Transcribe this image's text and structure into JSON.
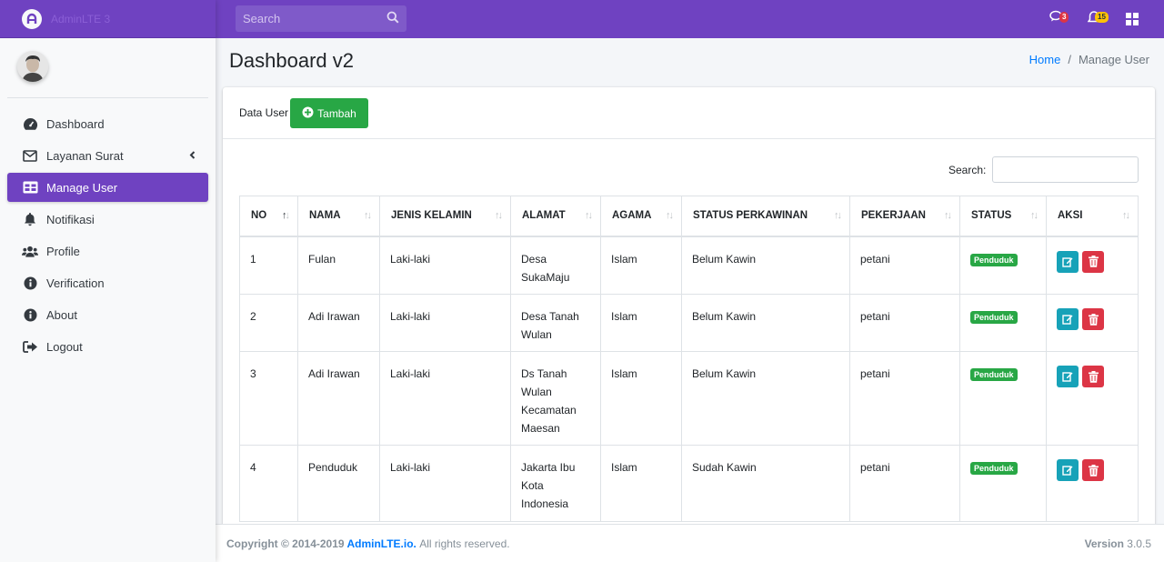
{
  "brand": {
    "name": "AdminLTE 3"
  },
  "navbar": {
    "search_placeholder": "Search",
    "messages_count": "3",
    "notifications_count": "15"
  },
  "sidebar": {
    "items": [
      {
        "label": "Dashboard",
        "icon": "tachometer-icon"
      },
      {
        "label": "Layanan Surat",
        "icon": "envelope-icon"
      },
      {
        "label": "Manage User",
        "icon": "table-icon"
      },
      {
        "label": "Notifikasi",
        "icon": "bell-icon"
      },
      {
        "label": "Profile",
        "icon": "users-icon"
      },
      {
        "label": "Verification",
        "icon": "info-circle-icon"
      },
      {
        "label": "About",
        "icon": "info-circle-icon"
      },
      {
        "label": "Logout",
        "icon": "sign-out-icon"
      }
    ]
  },
  "header": {
    "title": "Dashboard v2"
  },
  "breadcrumb": {
    "home": "Home",
    "current": "Manage User"
  },
  "card": {
    "title": "Data User",
    "add_label": "Tambah",
    "search_label": "Search:"
  },
  "table": {
    "columns": [
      "NO",
      "NAMA",
      "JENIS KELAMIN",
      "ALAMAT",
      "AGAMA",
      "STATUS PERKAWINAN",
      "PEKERJAAN",
      "STATUS",
      "AKSI"
    ],
    "rows": [
      {
        "no": "1",
        "nama": "Fulan",
        "jk": "Laki-laki",
        "alamat": "Desa SukaMaju",
        "agama": "Islam",
        "perkawinan": "Belum Kawin",
        "pekerjaan": "petani",
        "status": "Penduduk"
      },
      {
        "no": "2",
        "nama": "Adi Irawan",
        "jk": "Laki-laki",
        "alamat": "Desa Tanah Wulan",
        "agama": "Islam",
        "perkawinan": "Belum Kawin",
        "pekerjaan": "petani",
        "status": "Penduduk"
      },
      {
        "no": "3",
        "nama": "Adi Irawan",
        "jk": "Laki-laki",
        "alamat": "Ds Tanah Wulan Kecamatan Maesan",
        "agama": "Islam",
        "perkawinan": "Belum Kawin",
        "pekerjaan": "petani",
        "status": "Penduduk"
      },
      {
        "no": "4",
        "nama": "Penduduk",
        "jk": "Laki-laki",
        "alamat": "Jakarta Ibu Kota Indonesia",
        "agama": "Islam",
        "perkawinan": "Sudah Kawin",
        "pekerjaan": "petani",
        "status": "Penduduk"
      }
    ]
  },
  "footer": {
    "copyright": "Copyright © 2014-2019",
    "link": "AdminLTE.io.",
    "rights": "All rights reserved.",
    "version_label": "Version",
    "version": "3.0.5"
  },
  "colors": {
    "primary": "#6f42c1",
    "success": "#28a745",
    "info": "#17a2b8",
    "danger": "#dc3545",
    "warning": "#ffc107"
  }
}
